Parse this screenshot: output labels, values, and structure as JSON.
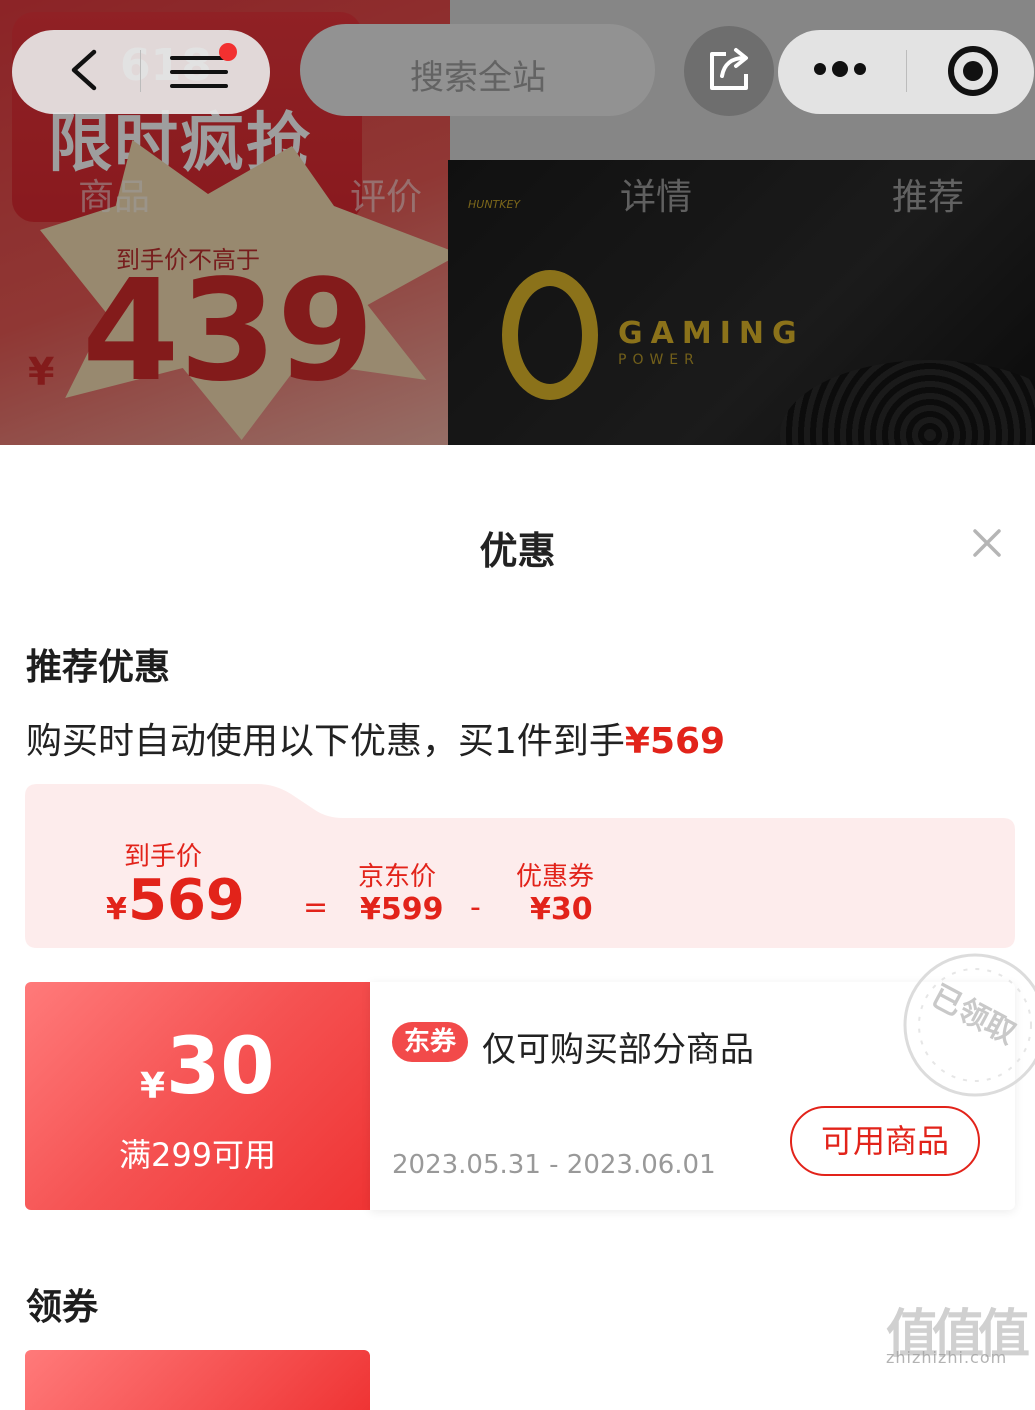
{
  "background": {
    "promo_618": "618",
    "promo_title": "限时疯抢",
    "promo_sub": "到手价不高于",
    "promo_yen": "¥",
    "promo_price": "439",
    "product_brand": "HUNTKEY",
    "product_gaming": "GAMING",
    "product_power": "POWER",
    "search_placeholder": "搜索全站",
    "tabs": [
      "商品",
      "评价",
      "详情",
      "推荐"
    ]
  },
  "nav": {
    "back_icon": "chevron-left-icon",
    "menu_icon": "hamburger-menu-icon",
    "share_icon": "share-icon",
    "more_icon": "more-dots-icon",
    "record_icon": "record-icon",
    "badge_color": "#f23030"
  },
  "sheet": {
    "title": "优惠",
    "close_icon": "close-icon"
  },
  "recommended": {
    "title": "推荐优惠",
    "note_prefix": "购买时自动使用以下优惠，买1件到手",
    "note_price": "¥569",
    "breakdown": {
      "final_label": "到手价",
      "final_yen": "¥",
      "final_value": "569",
      "equals": "=",
      "jd_label": "京东价",
      "jd_value": "¥599",
      "minus": "-",
      "coupon_label": "优惠券",
      "coupon_value": "¥30"
    }
  },
  "coupon": {
    "yen": "¥",
    "amount": "30",
    "condition": "满299可用",
    "tag": "东券",
    "description": "仅可购买部分商品",
    "date_range": "2023.05.31 - 2023.06.01",
    "button": "可用商品",
    "stamp": "已领取"
  },
  "claim": {
    "title": "领券"
  },
  "watermark": {
    "glyphs": [
      "值",
      "值",
      "值"
    ],
    "url": "zhizhizhi.com"
  },
  "colors": {
    "accent_red": "#e2231a",
    "coupon_gradient_start": "#ff7a7a",
    "coupon_gradient_end": "#ef3434",
    "breakdown_bg": "#fdecec"
  }
}
